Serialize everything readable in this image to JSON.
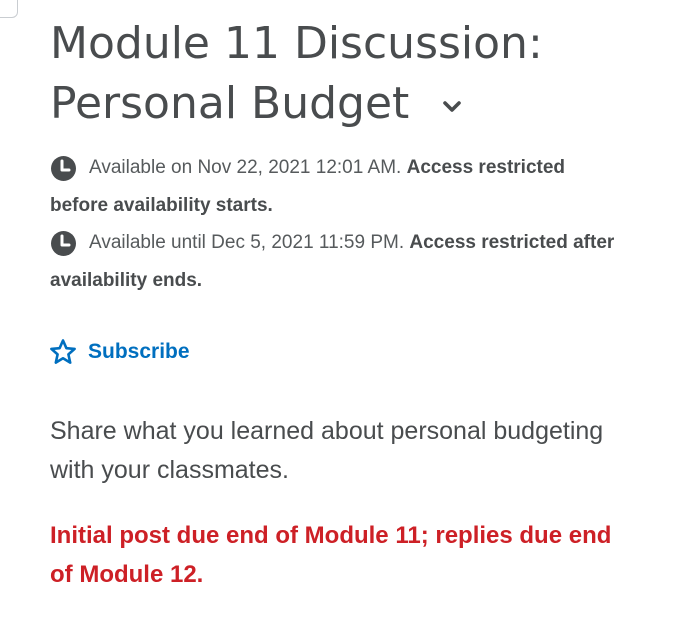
{
  "title": {
    "line1": "Module 11 Discussion:",
    "line2": "Personal Budget"
  },
  "availability": [
    {
      "icon": "clock-icon",
      "text": "Available on Nov 22, 2021 12:01 AM.",
      "restriction_first": "Access restricted",
      "restriction_rest": "before availability starts."
    },
    {
      "icon": "clock-icon",
      "text": "Available until Dec 5, 2021 11:59 PM.",
      "restriction_first": "Access restricted after",
      "restriction_rest": "availability ends."
    }
  ],
  "subscribe": {
    "icon": "star-outline-icon",
    "label": "Subscribe"
  },
  "description": {
    "line1": "Share what you learned about personal budgeting",
    "line2": "with your classmates."
  },
  "due_note": {
    "line1": "Initial post due end of Module 11; replies due end",
    "line2": "of Module 12."
  },
  "colors": {
    "text": "#494c4e",
    "link": "#006fbf",
    "due_note": "#cd2026",
    "icon_dark": "#494c4e"
  }
}
